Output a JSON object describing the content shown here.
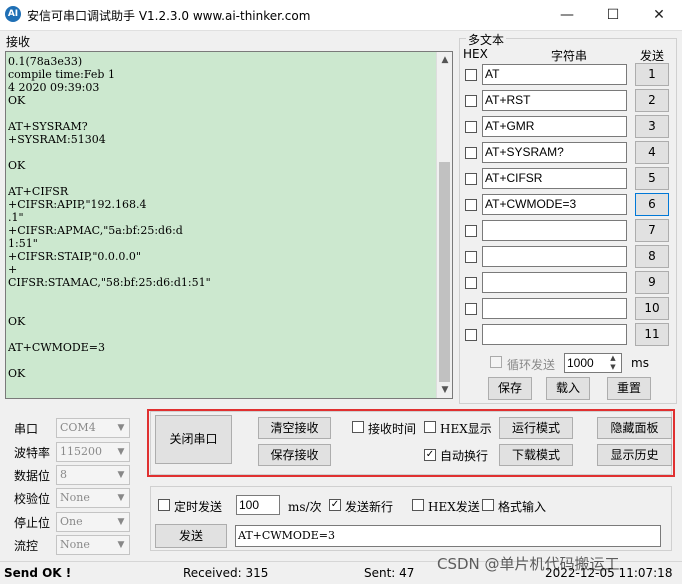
{
  "window": {
    "logo_text": "AI",
    "title": "安信可串口调试助手 V1.2.3.0    www.ai-thinker.com",
    "controls": {
      "minimize": "—",
      "maximize": "☐",
      "close": "✕"
    }
  },
  "receive": {
    "label": "接收",
    "text": "0.1(78a3e33)\ncompile time:Feb 1\n4 2020 09:39:03\nOK\n\nAT+SYSRAM?\n+SYSRAM:51304\n\nOK\n\nAT+CIFSR\n+CIFSR:APIP,\"192.168.4\n.1\"\n+CIFSR:APMAC,\"5a:bf:25:d6:d\n1:51\"\n+CIFSR:STAIP,\"0.0.0.0\"\n+\nCIFSR:STAMAC,\"58:bf:25:d6:d1:51\"\n\n\nOK\n\nAT+CWMODE=3\n\nOK"
  },
  "multi_text": {
    "title": "多文本",
    "col_hex": "HEX",
    "col_string": "字符串",
    "col_send": "发送",
    "rows": [
      {
        "value": "AT",
        "button": "1"
      },
      {
        "value": "AT+RST",
        "button": "2"
      },
      {
        "value": "AT+GMR",
        "button": "3"
      },
      {
        "value": "AT+SYSRAM?",
        "button": "4"
      },
      {
        "value": "AT+CIFSR",
        "button": "5"
      },
      {
        "value": "AT+CWMODE=3",
        "button": "6"
      },
      {
        "value": "",
        "button": "7"
      },
      {
        "value": "",
        "button": "8"
      },
      {
        "value": "",
        "button": "9"
      },
      {
        "value": "",
        "button": "10"
      },
      {
        "value": "",
        "button": "11"
      }
    ],
    "loop_send_label": "循环发送",
    "loop_interval": "1000",
    "loop_unit": "ms",
    "save": "保存",
    "load": "载入",
    "reset": "重置"
  },
  "port_settings": {
    "port_label": "串口",
    "port_value": "COM4",
    "baud_label": "波特率",
    "baud_value": "115200",
    "databits_label": "数据位",
    "databits_value": "8",
    "parity_label": "校验位",
    "parity_value": "None",
    "stopbits_label": "停止位",
    "stopbits_value": "One",
    "flow_label": "流控",
    "flow_value": "None"
  },
  "controls": {
    "close_port": "关闭串口",
    "clear_receive": "清空接收",
    "save_receive": "保存接收",
    "recv_time": "接收时间",
    "hex_display": "HEX显示",
    "auto_newline": "自动换行",
    "run_mode": "运行模式",
    "download_mode": "下载模式",
    "hide_panel": "隐藏面板",
    "show_history": "显示历史"
  },
  "send": {
    "timed_send": "定时发送",
    "interval": "100",
    "interval_unit": "ms/次",
    "send_newline": "发送新行",
    "hex_send": "HEX发送",
    "format_input": "格式输入",
    "send_button": "发送",
    "input_value": "AT+CWMODE=3"
  },
  "status": {
    "send_ok": "Send OK !",
    "received": "Received: 315",
    "sent": "Sent: 47",
    "datetime": "2022-12-05 11:07:18"
  },
  "watermark": "CSDN @单片机代码搬运工"
}
